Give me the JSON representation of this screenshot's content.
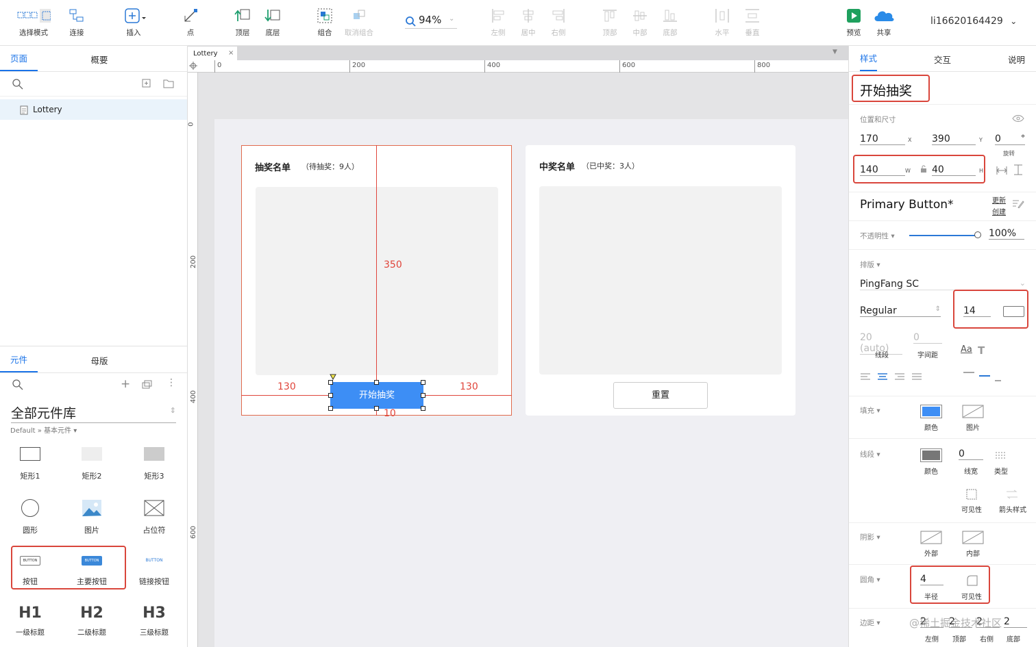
{
  "toolbar": {
    "items": [
      {
        "label": "选择模式",
        "icon": "select-mode-icon"
      },
      {
        "label": "连接",
        "icon": "connect-icon"
      },
      {
        "label": "插入",
        "icon": "insert-icon"
      },
      {
        "label": "点",
        "icon": "point-icon"
      },
      {
        "label": "顶层",
        "icon": "bring-front-icon"
      },
      {
        "label": "底层",
        "icon": "send-back-icon"
      },
      {
        "label": "组合",
        "icon": "group-icon"
      },
      {
        "label": "取消组合",
        "icon": "ungroup-icon"
      },
      {
        "label": "左侧",
        "icon": "align-left-icon"
      },
      {
        "label": "居中",
        "icon": "align-center-icon"
      },
      {
        "label": "右侧",
        "icon": "align-right-icon"
      },
      {
        "label": "顶部",
        "icon": "align-top-icon"
      },
      {
        "label": "中部",
        "icon": "align-middle-icon"
      },
      {
        "label": "底部",
        "icon": "align-bottom-icon"
      },
      {
        "label": "水平",
        "icon": "distribute-h-icon"
      },
      {
        "label": "垂直",
        "icon": "distribute-v-icon"
      },
      {
        "label": "预览",
        "icon": "preview-icon"
      },
      {
        "label": "共享",
        "icon": "share-cloud-icon"
      }
    ],
    "zoom": "94%",
    "user": "li16620164429"
  },
  "left": {
    "tabs": [
      "页面",
      "概要"
    ],
    "page": "Lottery",
    "lib_tabs": [
      "元件",
      "母版"
    ],
    "library": "全部元件库",
    "breadcrumb": "Default » 基本元件",
    "widgets": [
      "矩形1",
      "矩形2",
      "矩形3",
      "圆形",
      "图片",
      "占位符",
      "按钮",
      "主要按钮",
      "链接按钮",
      "一级标题",
      "二级标题",
      "三级标题"
    ],
    "btn_text": "BUTTON",
    "headings": [
      "H1",
      "H2",
      "H3"
    ]
  },
  "canvas": {
    "tab": "Lottery",
    "ruler_h": [
      "0",
      "200",
      "400",
      "600",
      "800"
    ],
    "ruler_v": [
      "0",
      "200",
      "400",
      "600"
    ],
    "card1_title": "抽奖名单",
    "card1_sub": "（待抽奖：9人）",
    "card2_title": "中奖名单",
    "card2_sub": "（已中奖：3人）",
    "start_btn": "开始抽奖",
    "reset_btn": "重置",
    "m_350": "350",
    "m_130": "130",
    "m_10": "10"
  },
  "right": {
    "tabs": [
      "样式",
      "交互",
      "说明"
    ],
    "name": "开始抽奖",
    "pos_title": "位置和尺寸",
    "x": "170",
    "x_l": "X",
    "y": "390",
    "y_l": "Y",
    "rot": "0",
    "rot_unit": "°",
    "rot_l": "旋转",
    "w": "140",
    "w_l": "W",
    "h": "40",
    "h_l": "H",
    "style_name": "Primary Button*",
    "update": "更新",
    "create": "创建",
    "opacity_l": "不透明性",
    "opacity": "100%",
    "opacity_level": 1.0,
    "type_l": "排版",
    "font": "PingFang SC",
    "weight": "Regular",
    "size": "14",
    "line_h": "20 (auto)",
    "spacing": "0",
    "line_h_l": "线段",
    "spacing_l": "字间距",
    "fill_l": "填充",
    "color_l": "颜色",
    "image_l": "图片",
    "stroke_l": "线段",
    "stroke_w": "0",
    "stroke_w_l": "线宽",
    "stroke_type_l": "类型",
    "visible_l": "可见性",
    "arrow_l": "箭头样式",
    "shadow_l": "阴影",
    "outer_l": "外部",
    "inner_l": "内部",
    "radius_l": "圆角",
    "radius": "4",
    "radius_sub": "半径",
    "margin_l": "边距",
    "margins": [
      "2",
      "2",
      "2",
      "2"
    ],
    "margin_names": [
      "左侧",
      "顶部",
      "右侧",
      "底部"
    ],
    "watermark": "@稀土掘金技术社区",
    "fill_color": "#3d8ef5",
    "stroke_color": "#777777"
  }
}
